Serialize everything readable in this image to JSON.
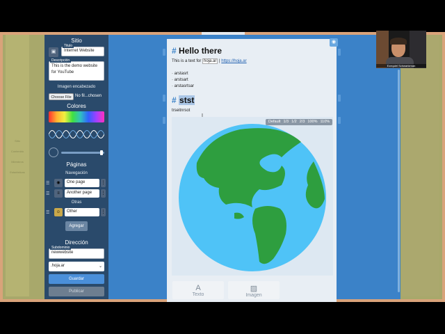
{
  "sidebar": {
    "title": "Sitio",
    "logo_icon": "image-icon",
    "titulo_label": "Titulo",
    "titulo_value": "Internet Website",
    "descripcion_label": "Descripción",
    "descripcion_value": "This is the demo website for YouTube",
    "imagen_label": "Imagen encabezado",
    "choose_file": "Choose File",
    "no_file": "No fil...chosen",
    "colores_label": "Colores",
    "paginas_label": "Páginas",
    "navegacion_label": "Navegación",
    "nav_pages": [
      {
        "icon": "globe-icon",
        "label": "One page"
      },
      {
        "icon": "menu-icon",
        "label": "Another page"
      }
    ],
    "otras_label": "Otras",
    "other_pages": [
      {
        "icon": "emoji-icon",
        "label": "Other"
      }
    ],
    "agregar": "Agregar",
    "direccion_label": "Dirección",
    "subdominio_label": "Subdominio",
    "subdominio_value": "newwebsite",
    "domain_select": ".hoja.ar",
    "guardar": "Guardar",
    "publicar": "Publicar"
  },
  "left_ghost": [
    "Sitio",
    "Contenido",
    "Miembros",
    "Estadísticas"
  ],
  "document": {
    "h1": "Hello there",
    "intro_text": "This is a text for ",
    "intro_code": "hoja.ar",
    "intro_link": "https://hoja.ar",
    "list": [
      "· arstasrt",
      "· arstsart",
      "· arstasrtsar"
    ],
    "h2": "stst",
    "para": "trseitnrsot",
    "hash": "#"
  },
  "image_zoom_options": [
    "Default",
    "1/3",
    "1/2",
    "2/3",
    "100%",
    "110%"
  ],
  "tools": [
    {
      "icon": "text-icon",
      "label": "Texto"
    },
    {
      "icon": "image-icon",
      "label": "Imagen"
    }
  ],
  "webcam": {
    "name": "Ezequiel Schwartzman"
  },
  "colors": {
    "sidebar": "#2a4a6b",
    "main_bg": "#3b82c8",
    "ocean": "#4fc3f7",
    "land": "#2e9e3f"
  }
}
